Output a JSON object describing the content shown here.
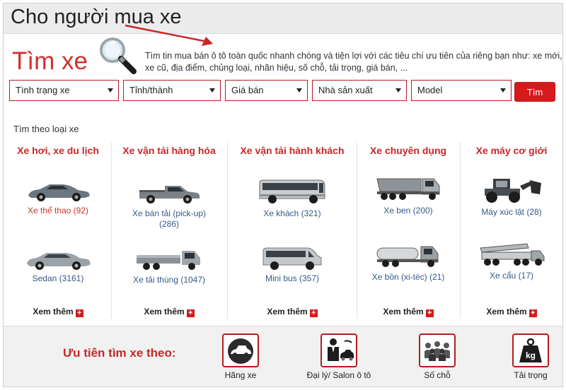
{
  "header": {
    "title": "Cho người mua xe"
  },
  "search": {
    "title": "Tìm xe",
    "description": "Tìm tin mua bán ô tô toàn quốc nhanh chóng và tiện lợi với các tiêu chí ưu tiên của riêng bạn như: xe mới, xe cũ, địa điểm, chủng loại, nhãn hiệu, số chỗ, tải trọng, giá bán, ..."
  },
  "filters": [
    {
      "label": "Tình trạng xe"
    },
    {
      "label": "Tỉnh/thành"
    },
    {
      "label": "Giá bán"
    },
    {
      "label": "Nhà sản xuất"
    },
    {
      "label": "Model"
    }
  ],
  "search_button": "Tìm",
  "type_heading": "Tìm theo loại xe",
  "more_label": "Xem thêm",
  "categories": [
    {
      "title": "Xe hơi, xe du lịch",
      "items": [
        {
          "label": "Xe thể thao (92)",
          "icon": "sports-car-icon"
        },
        {
          "label": "Sedan (3161)",
          "icon": "sedan-icon"
        }
      ]
    },
    {
      "title": "Xe vận tải hàng hóa",
      "items": [
        {
          "label": "Xe bán tải (pick-up) (286)",
          "icon": "pickup-icon"
        },
        {
          "label": "Xe tải thùng (1047)",
          "icon": "box-truck-icon"
        }
      ]
    },
    {
      "title": "Xe vận tải hành khách",
      "items": [
        {
          "label": "Xe khách (321)",
          "icon": "coach-bus-icon"
        },
        {
          "label": "Mini bus (357)",
          "icon": "minibus-icon"
        }
      ]
    },
    {
      "title": "Xe chuyên dụng",
      "items": [
        {
          "label": "Xe ben (200)",
          "icon": "dump-truck-icon"
        },
        {
          "label": "Xe bồn (xi-téc) (21)",
          "icon": "tanker-icon"
        }
      ]
    },
    {
      "title": "Xe máy cơ giới",
      "items": [
        {
          "label": "Máy xúc lật (28)",
          "icon": "loader-icon"
        },
        {
          "label": "Xe cẩu (17)",
          "icon": "crane-icon"
        }
      ]
    }
  ],
  "priority": {
    "label": "Ưu tiên tìm xe theo:",
    "options": [
      {
        "label": "Hãng xe",
        "icon": "car-brand-icon"
      },
      {
        "label": "Đại lý/ Salon ô tô",
        "icon": "dealer-icon"
      },
      {
        "label": "Số chỗ",
        "icon": "seats-icon"
      },
      {
        "label": "Tải trọng",
        "icon": "weight-icon"
      }
    ]
  },
  "colors": {
    "accent": "#d7191c",
    "heading_red": "#c62828",
    "link_blue": "#335a8a"
  }
}
